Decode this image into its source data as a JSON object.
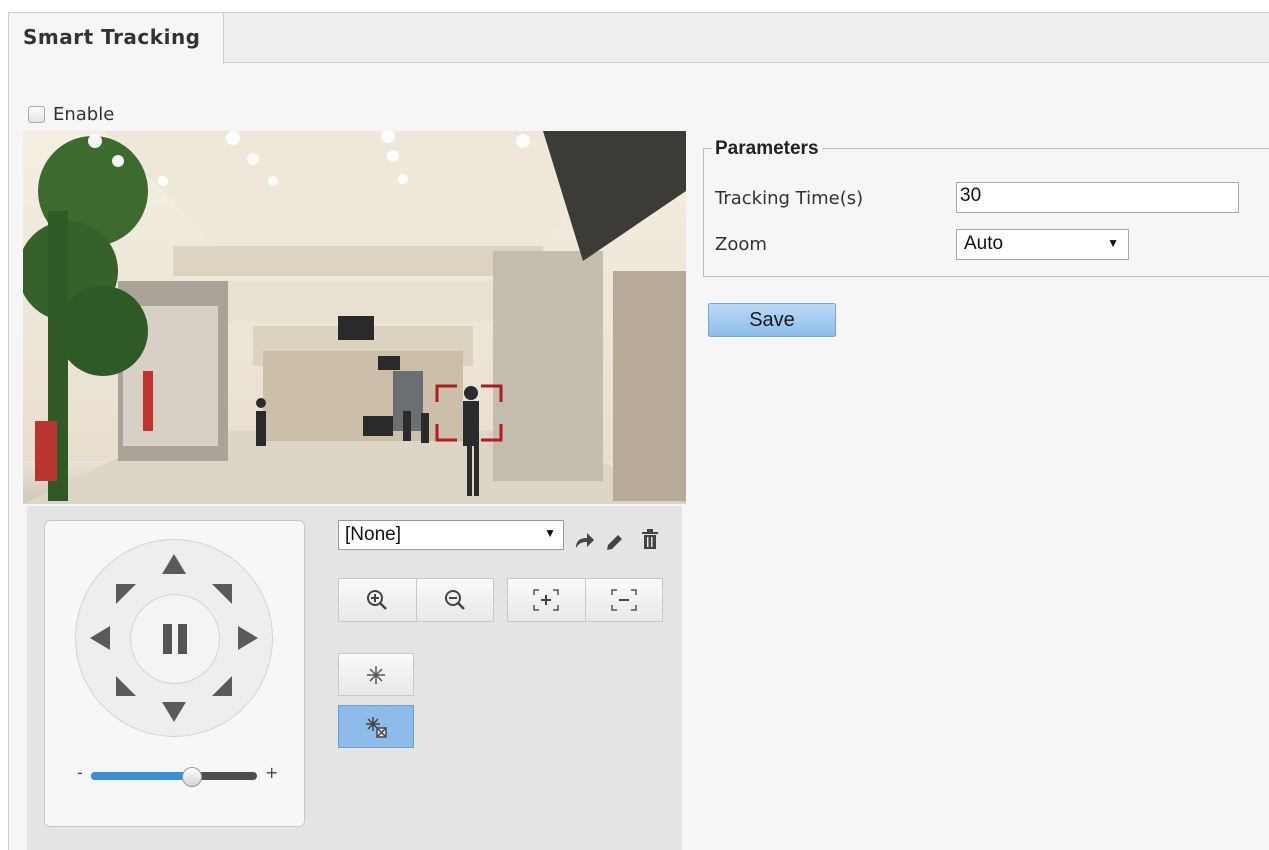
{
  "tab": {
    "title": "Smart Tracking"
  },
  "enable": {
    "label": "Enable",
    "checked": false
  },
  "video": {
    "description_icon": "camera-live-view"
  },
  "ptz": {
    "preset_selected": "[None]",
    "speed_minus": "-",
    "speed_plus": "+",
    "speed_level": 0.6
  },
  "parameters": {
    "title": "Parameters",
    "tracking_time_label": "Tracking Time(s)",
    "tracking_time_value": "30",
    "zoom_label": "Zoom",
    "zoom_value": "Auto"
  },
  "actions": {
    "save_label": "Save"
  },
  "colors": {
    "accent": "#8dbdeb",
    "tracking_box": "#b01c1c",
    "slider_fill": "#3d8fd8"
  }
}
